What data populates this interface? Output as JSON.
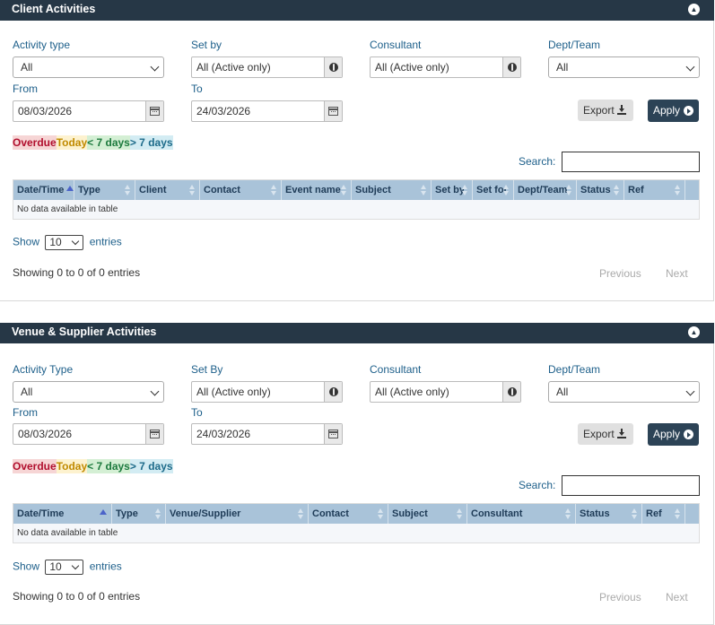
{
  "panels": [
    {
      "title": "Client Activities",
      "filters": {
        "activity_type": {
          "label": "Activity type",
          "value": "All"
        },
        "set_by": {
          "label": "Set by",
          "value": "All (Active only)"
        },
        "consultant": {
          "label": "Consultant",
          "value": "All (Active only)"
        },
        "dept_team": {
          "label": "Dept/Team",
          "value": "All"
        },
        "from": {
          "label": "From",
          "value": "08/03/2026"
        },
        "to": {
          "label": "To",
          "value": "24/03/2026"
        }
      },
      "export_label": "Export",
      "apply_label": "Apply",
      "legend": {
        "overdue": "Overdue",
        "today": "Today",
        "week": "< 7 days",
        "more": "> 7 days"
      },
      "search_label": "Search:",
      "columns": [
        "Date/Time",
        "Type",
        "Client",
        "Contact",
        "Event name",
        "Subject",
        "Set by",
        "Set for",
        "Dept/Team",
        "Status",
        "Ref"
      ],
      "empty_text": "No data available in table",
      "show_label": "Show",
      "page_length": "10",
      "entries_label": "entries",
      "info_text": "Showing 0 to 0 of 0 entries",
      "previous_label": "Previous",
      "next_label": "Next"
    },
    {
      "title": "Venue & Supplier Activities",
      "filters": {
        "activity_type": {
          "label": "Activity Type",
          "value": "All"
        },
        "set_by": {
          "label": "Set By",
          "value": "All (Active only)"
        },
        "consultant": {
          "label": "Consultant",
          "value": "All (Active only)"
        },
        "dept_team": {
          "label": "Dept/Team",
          "value": "All"
        },
        "from": {
          "label": "From",
          "value": "08/03/2026"
        },
        "to": {
          "label": "To",
          "value": "24/03/2026"
        }
      },
      "export_label": "Export",
      "apply_label": "Apply",
      "legend": {
        "overdue": "Overdue",
        "today": "Today",
        "week": "< 7 days",
        "more": "> 7 days"
      },
      "search_label": "Search:",
      "columns": [
        "Date/Time",
        "Type",
        "Venue/Supplier",
        "Contact",
        "Subject",
        "Consultant",
        "Status",
        "Ref"
      ],
      "empty_text": "No data available in table",
      "show_label": "Show",
      "page_length": "10",
      "entries_label": "entries",
      "info_text": "Showing 0 to 0 of 0 entries",
      "previous_label": "Previous",
      "next_label": "Next"
    }
  ]
}
